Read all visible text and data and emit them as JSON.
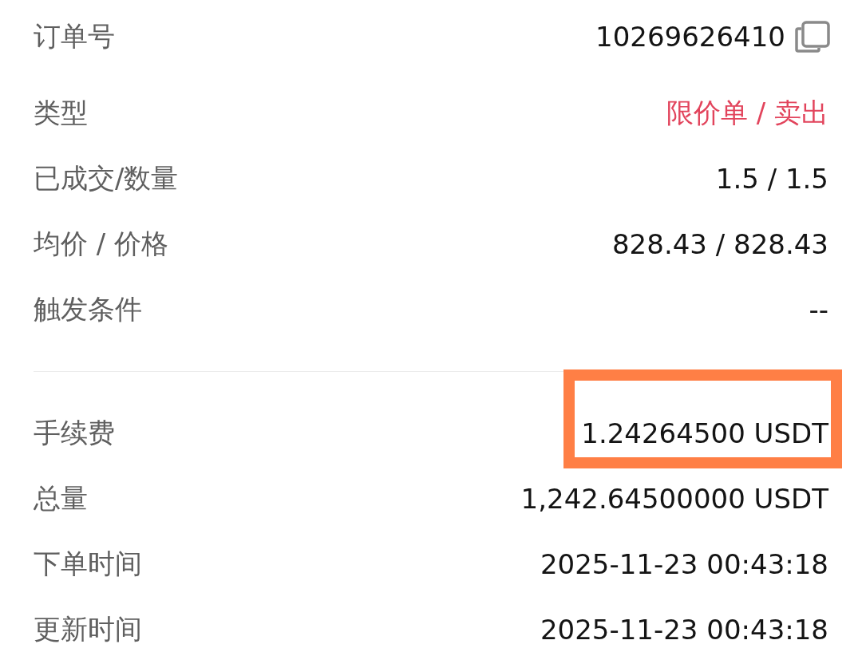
{
  "sections": [
    {
      "rows": [
        {
          "label": "订单号",
          "value": "10269626410",
          "kind": "copyable",
          "color": "#141414",
          "highlighted": false
        },
        {
          "label": "类型",
          "value": "限价单 / 卖出",
          "kind": "plain",
          "color": "#e2445c",
          "highlighted": false
        },
        {
          "label": "已成交/数量",
          "value": "1.5 / 1.5",
          "kind": "plain",
          "color": "#141414",
          "highlighted": false
        },
        {
          "label": "均价 / 价格",
          "value": "828.43 / 828.43",
          "kind": "plain",
          "color": "#141414",
          "highlighted": false
        },
        {
          "label": "触发条件",
          "value": "--",
          "kind": "plain",
          "color": "#141414",
          "highlighted": false
        }
      ]
    },
    {
      "rows": [
        {
          "label": "手续费",
          "value": "1.24264500 USDT",
          "kind": "plain",
          "color": "#141414",
          "highlighted": true
        },
        {
          "label": "总量",
          "value": "1,242.64500000 USDT",
          "kind": "plain",
          "color": "#141414",
          "highlighted": false
        },
        {
          "label": "下单时间",
          "value": "2025-11-23 00:43:18",
          "kind": "plain",
          "color": "#141414",
          "highlighted": false
        },
        {
          "label": "更新时间",
          "value": "2025-11-23 00:43:18",
          "kind": "plain",
          "color": "#141414",
          "highlighted": false
        }
      ]
    }
  ]
}
